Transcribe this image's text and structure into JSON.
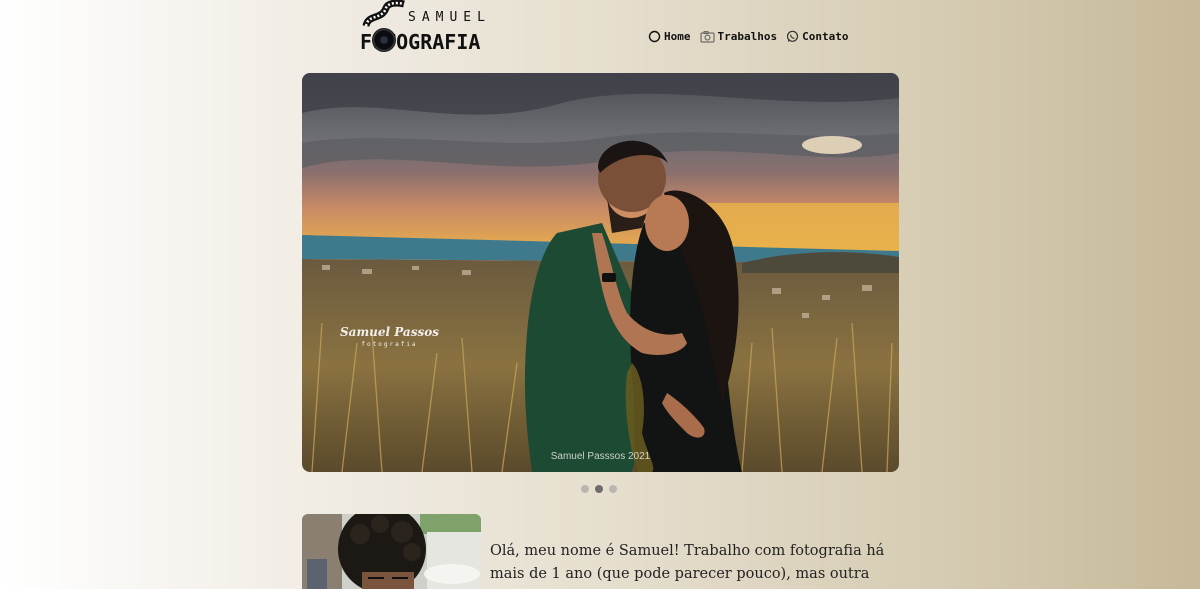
{
  "brand": {
    "top": "SAMUEL",
    "bottom": "FOTOGRAFIA",
    "icons": [
      "film-strip-icon",
      "camera-lens-icon"
    ]
  },
  "nav": {
    "items": [
      {
        "label": "Home",
        "icon": "circle-icon"
      },
      {
        "label": "Trabalhos",
        "icon": "camera-icon"
      },
      {
        "label": "Contato",
        "icon": "whatsapp-icon"
      }
    ]
  },
  "carousel": {
    "watermark_name": "Samuel Passos",
    "watermark_sub": "fotografia",
    "caption": "Samuel Passsos 2021",
    "slide_count": 3,
    "active_index": 1
  },
  "about": {
    "text": "Olá, meu nome é Samuel! Trabalho com fotografia há mais de 1 ano (que pode parecer pouco), mas outra vez ouvi dizer que não"
  },
  "colors": {
    "background_left": "#ffffff",
    "background_right": "#c6b999",
    "dot_active": "#6e6d6a",
    "dot_inactive": "#b9b6b0"
  }
}
